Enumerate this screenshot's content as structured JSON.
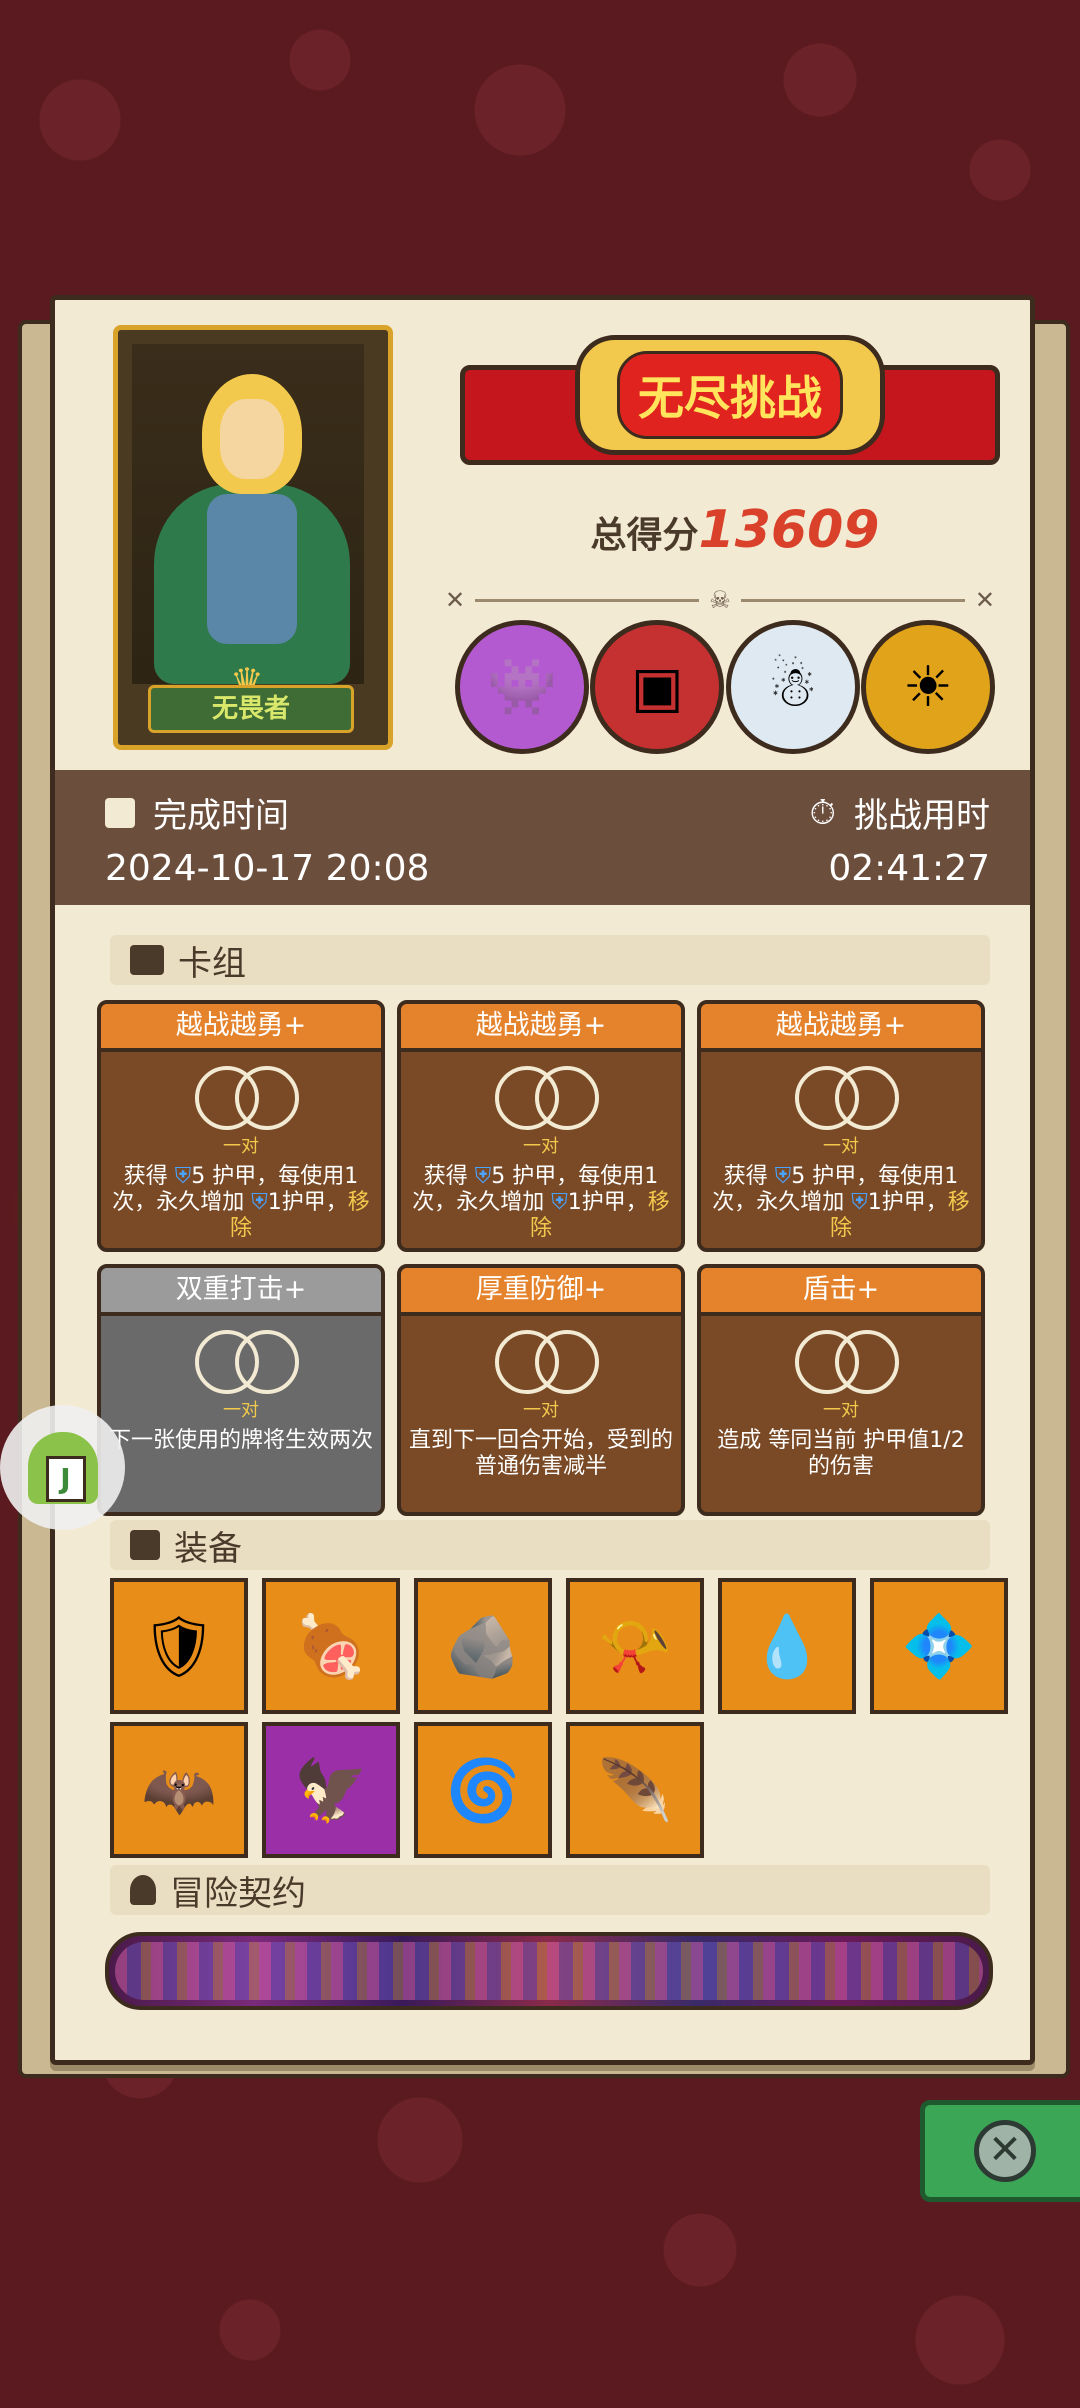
{
  "hero": {
    "name": "无畏者"
  },
  "banner": {
    "title": "无尽挑战"
  },
  "score": {
    "label": "总得分",
    "value": "13609"
  },
  "stats": {
    "finish_label": "完成时间",
    "finish_value": "2024-10-17 20:08",
    "duration_label": "挑战用时",
    "duration_value": "02:41:27"
  },
  "sections": {
    "deck": "卡组",
    "equipment": "装备",
    "contract": "冒险契约"
  },
  "cards": [
    {
      "title": "越战越勇+",
      "pair": "一对",
      "desc_a": "获得 ",
      "desc_b": "5 护甲，每使用1次，永久增加 ",
      "desc_c": "1护甲，",
      "desc_hl": "移除"
    },
    {
      "title": "越战越勇+",
      "pair": "一对",
      "desc_a": "获得 ",
      "desc_b": "5 护甲，每使用1次，永久增加 ",
      "desc_c": "1护甲，",
      "desc_hl": "移除"
    },
    {
      "title": "越战越勇+",
      "pair": "一对",
      "desc_a": "获得 ",
      "desc_b": "5 护甲，每使用1次，永久增加 ",
      "desc_c": "1护甲，",
      "desc_hl": "移除"
    },
    {
      "title": "双重打击+",
      "pair": "一对",
      "desc": "下一张使用的牌将生效两次"
    },
    {
      "title": "厚重防御+",
      "pair": "一对",
      "desc": "直到下一回合开始，受到的普通伤害减半"
    },
    {
      "title": "盾击+",
      "pair": "一对",
      "desc": "造成 等同当前 护甲值1/2的伤害"
    }
  ],
  "bosses": [
    "purple-monster-icon",
    "cage-monster-icon",
    "yeti-icon",
    "pumpkin-icon"
  ],
  "equipment_row1": [
    "armor-icon",
    "meat-icon",
    "moss-stone-icon",
    "horn-icon",
    "blue-slime-icon",
    "crystal-shield-icon"
  ],
  "equipment_row2": [
    "bat-icon",
    "claw-icon",
    "orb-icon",
    "feather-icon"
  ],
  "colors": {
    "accent_red": "#c4161c",
    "score_red": "#d9412b",
    "card_orange": "#e5832c",
    "panel": "#f3ead3"
  }
}
